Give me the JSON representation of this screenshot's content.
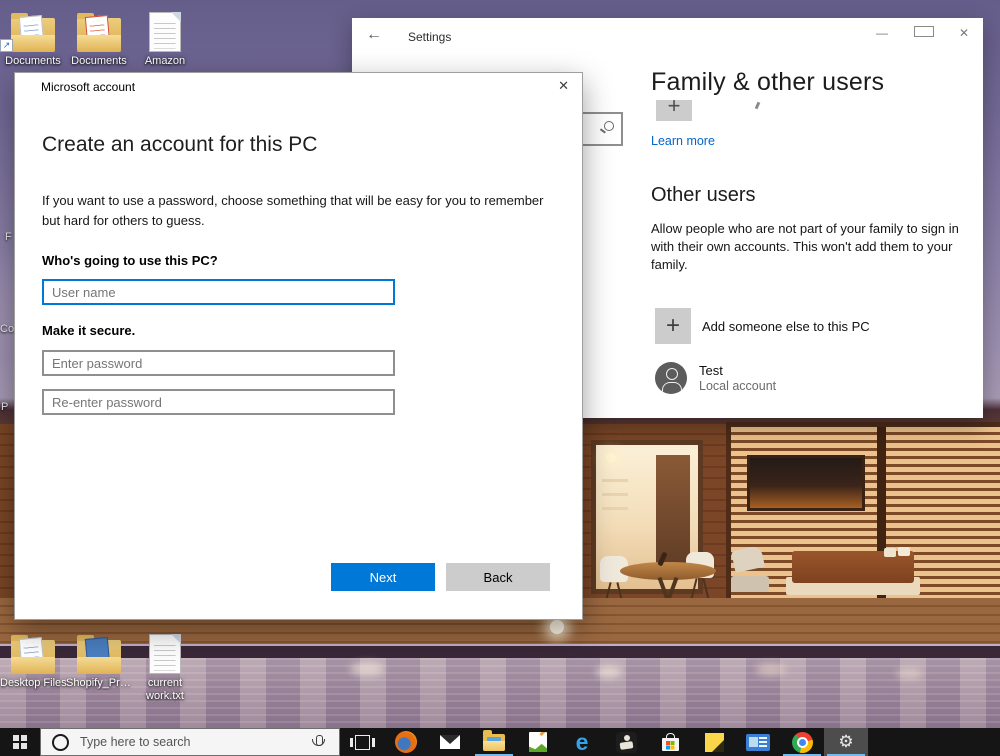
{
  "desktop": {
    "icons_top": [
      {
        "label": "Documents"
      },
      {
        "label": "Documents"
      },
      {
        "label": "Amazon"
      }
    ],
    "icons_bottom": [
      {
        "label": "Desktop Files"
      },
      {
        "label": "Shopify_Pro..."
      },
      {
        "label": "current work.txt"
      }
    ],
    "edge_fragments": {
      "f1": "F",
      "f2": "Co",
      "f3": "P"
    },
    "shortcut_arrow_glyph": "↗"
  },
  "settings_window": {
    "title": "Settings",
    "back_glyph": "←",
    "controls": {
      "minimize": "—",
      "close": "✕"
    },
    "page": {
      "heading": "Family & other users",
      "plus_glyph": "+",
      "learn_more": "Learn more",
      "other_users_heading": "Other users",
      "other_users_desc": "Allow people who are not part of your family to sign in with their own accounts. This won't add them to your family.",
      "add_other_label": "Add someone else to this PC",
      "user": {
        "name": "Test",
        "type": "Local account"
      }
    }
  },
  "dialog": {
    "title": "Microsoft account",
    "close_glyph": "✕",
    "heading": "Create an account for this PC",
    "description": "If you want to use a password, choose something that will be easy for you to remember but hard for others to guess.",
    "who_label": "Who's going to use this PC?",
    "username_placeholder": "User name",
    "secure_label": "Make it secure.",
    "password_placeholder": "Enter password",
    "reenter_placeholder": "Re-enter password",
    "next_label": "Next",
    "back_label": "Back"
  },
  "taskbar": {
    "search_placeholder": "Type here to search",
    "edge_glyph": "e",
    "gear_glyph": "⚙"
  },
  "colors": {
    "accent": "#0078d7",
    "link": "#0066cc",
    "taskbar_underline": "#76b9ed"
  }
}
